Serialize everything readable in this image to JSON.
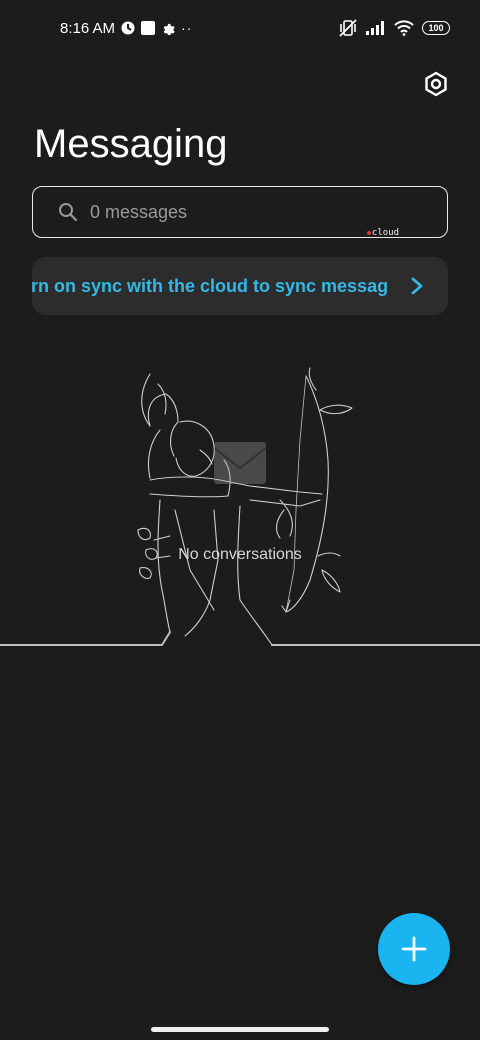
{
  "status_bar": {
    "time": "8:16 AM",
    "battery": "100",
    "left_icons": [
      "data-saver-icon",
      "square-notification-icon",
      "gear-icon",
      "more-dots-icon"
    ],
    "right_icons": [
      "mute-vibrate-icon",
      "signal-icon",
      "wifi-icon",
      "battery-icon"
    ]
  },
  "header": {
    "title": "Messaging",
    "settings_icon": "settings-hexagon-icon"
  },
  "search": {
    "placeholder": "0 messages",
    "watermark": "cloud"
  },
  "sync_banner": {
    "text": "urn on sync with the cloud to sync messag",
    "accent_color": "#35b8e6"
  },
  "empty_state": {
    "text": "No conversations"
  },
  "fab": {
    "icon": "plus-icon",
    "color": "#1ab4f0"
  }
}
